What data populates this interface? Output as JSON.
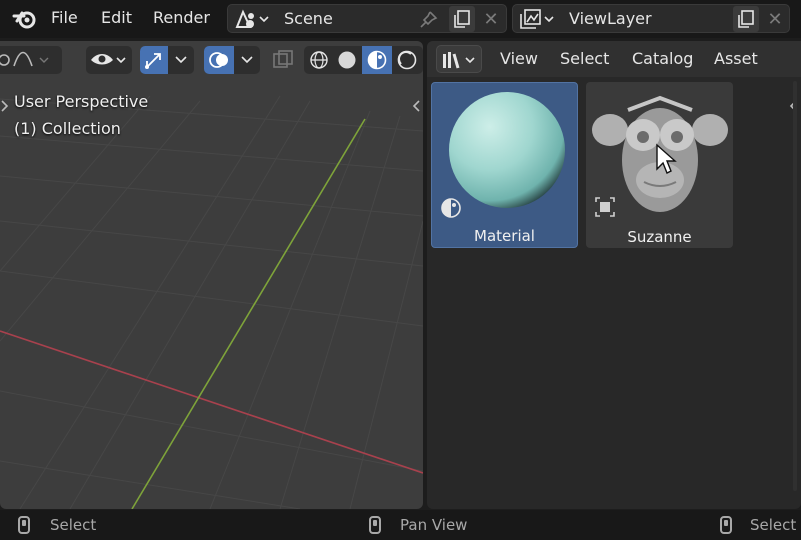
{
  "menubar": {
    "file": "File",
    "edit": "Edit",
    "render": "Render"
  },
  "scene": {
    "value": "Scene"
  },
  "view_layer": {
    "value": "ViewLayer"
  },
  "viewport": {
    "perspective_text": "User Perspective",
    "collection_text": "(1) Collection"
  },
  "asset_browser": {
    "menus": [
      "View",
      "Select",
      "Catalog",
      "Asset"
    ],
    "tiles": [
      {
        "label": "Material",
        "selected": true
      },
      {
        "label": "Suzanne",
        "selected": false
      }
    ]
  },
  "statusbar": {
    "left": "Select",
    "middle": "Pan View",
    "right": "Select"
  },
  "colors": {
    "accent": "#4772b3",
    "selected_tile": "#3d5a85",
    "x_axis": "#b33a4a",
    "y_axis": "#7ea33a"
  }
}
